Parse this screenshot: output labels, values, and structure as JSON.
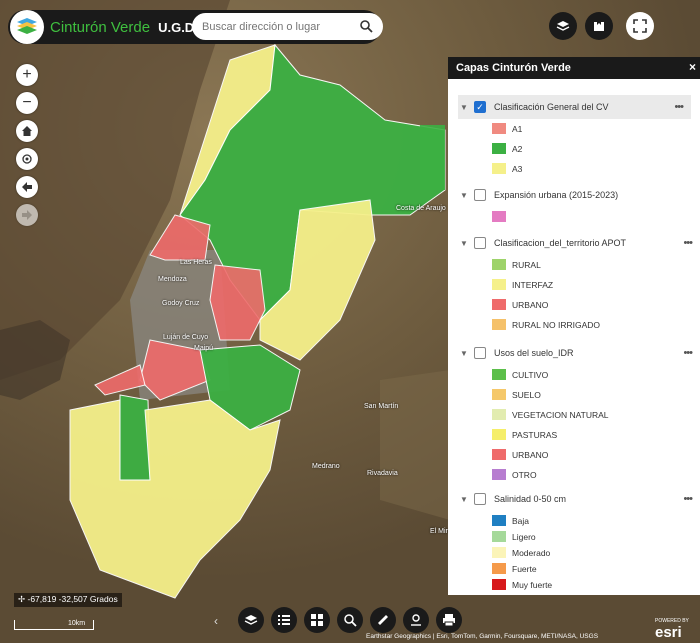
{
  "header": {
    "title": "Cinturón Verde",
    "subtitle": "U.G.D.T.",
    "search_placeholder": "Buscar dirección o lugar"
  },
  "map": {
    "labels": {
      "las_heras": "Las Heras",
      "mendoza": "Mendoza",
      "godoy_cruz": "Godoy Cruz",
      "lujan": "Luján de Cuyo",
      "maipu": "Maipú",
      "costa": "Costa de Araujo",
      "san_martin": "San Martín",
      "medrano": "Medrano",
      "rivadavia": "Rivadavia",
      "el_mira": "El Mira"
    }
  },
  "panel": {
    "title": "Capas Cinturón Verde",
    "close": "×",
    "layers": [
      {
        "label": "Clasificación General del CV",
        "checked": true,
        "items": [
          {
            "label": "A1",
            "color": "#f08a80"
          },
          {
            "label": "A2",
            "color": "#3cb043"
          },
          {
            "label": "A3",
            "color": "#f5f08a"
          }
        ]
      },
      {
        "label": "Expansión urbana (2015-2023)",
        "checked": false,
        "items": [
          {
            "label": "",
            "color": "#e47bc2"
          }
        ]
      },
      {
        "label": "Clasificacion_del_territorio APOT",
        "checked": false,
        "items": [
          {
            "label": "RURAL",
            "color": "#9ed36a"
          },
          {
            "label": "INTERFAZ",
            "color": "#f5f08a"
          },
          {
            "label": "URBANO",
            "color": "#ef6b6b"
          },
          {
            "label": "RURAL NO IRRIGADO",
            "color": "#f5c16a"
          }
        ]
      },
      {
        "label": "Usos del suelo_IDR",
        "checked": false,
        "items": [
          {
            "label": "CULTIVO",
            "color": "#5cbf4a"
          },
          {
            "label": "SUELO",
            "color": "#f5c86a"
          },
          {
            "label": "VEGETACION NATURAL",
            "color": "#e2ecb0"
          },
          {
            "label": "PASTURAS",
            "color": "#f5ee6a"
          },
          {
            "label": "URBANO",
            "color": "#ef6b6b"
          },
          {
            "label": "OTRO",
            "color": "#b77dd0"
          }
        ]
      },
      {
        "label": "Salinidad 0-50 cm",
        "checked": false,
        "items": [
          {
            "label": "Baja",
            "color": "#1f7fc2"
          },
          {
            "label": "Ligero",
            "color": "#a5d99a"
          },
          {
            "label": "Moderado",
            "color": "#fbf4b8"
          },
          {
            "label": "Fuerte",
            "color": "#f59a4a"
          },
          {
            "label": "Muy fuerte",
            "color": "#d7191c"
          }
        ]
      }
    ]
  },
  "status": {
    "coordinates": "-67,819 -32,507 Grados",
    "scale": "10km"
  },
  "attribution": "Earthstar Geographics | Esri, TomTom, Garmin, Foursquare, METI/NASA, USGS",
  "esri": {
    "powered": "POWERED BY",
    "brand": "esri"
  }
}
